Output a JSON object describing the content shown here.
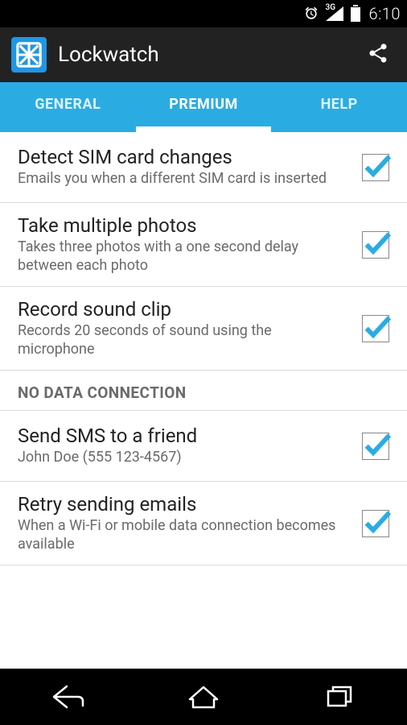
{
  "status": {
    "time": "6:10"
  },
  "actionbar": {
    "title": "Lockwatch"
  },
  "tabs": [
    {
      "label": "GENERAL",
      "active": false
    },
    {
      "label": "PREMIUM",
      "active": true
    },
    {
      "label": "HELP",
      "active": false
    }
  ],
  "sections": {
    "header1": "NO DATA CONNECTION"
  },
  "settings": [
    {
      "title": "Detect SIM card changes",
      "sub": "Emails you when a different SIM card is inserted",
      "checked": true
    },
    {
      "title": "Take multiple photos",
      "sub": "Takes three photos with a one second delay between each photo",
      "checked": true
    },
    {
      "title": "Record sound clip",
      "sub": "Records 20 seconds of sound using the microphone",
      "checked": true
    },
    {
      "title": "Send SMS to a friend",
      "sub": "John Doe (555 123-4567)",
      "checked": true
    },
    {
      "title": "Retry sending emails",
      "sub": "When a Wi-Fi or mobile data connection becomes available",
      "checked": true
    }
  ]
}
